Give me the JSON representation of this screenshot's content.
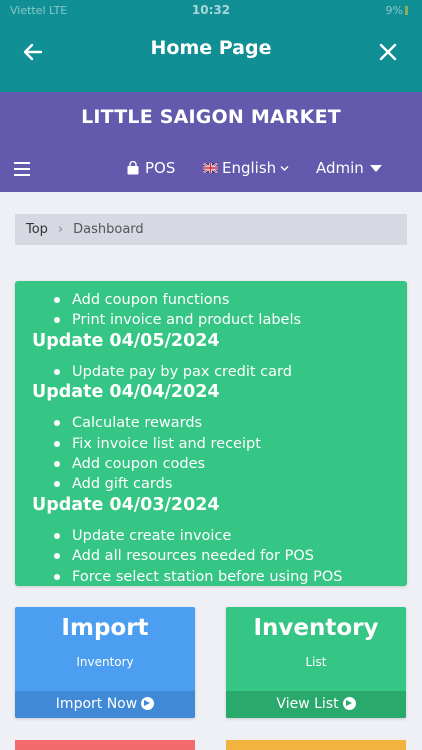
{
  "status_bar": {
    "carrier": "Viettel  LTE",
    "time": "10:32",
    "battery": "9%"
  },
  "header": {
    "title": "Home Page"
  },
  "nav": {
    "store_name": "LITTLE SAIGON MARKET",
    "pos_label": "POS",
    "language_label": "English",
    "admin_label": "Admin"
  },
  "breadcrumb": {
    "root": "Top",
    "current": "Dashboard"
  },
  "updates": {
    "top_items": [
      "Add coupon functions",
      "Print invoice and product labels"
    ],
    "sections": [
      {
        "title": "Update 04/05/2024",
        "items": [
          "Update pay by pax credit card"
        ]
      },
      {
        "title": "Update 04/04/2024",
        "items": [
          "Calculate rewards",
          "Fix invoice list and receipt",
          "Add coupon codes",
          "Add gift cards"
        ]
      },
      {
        "title": "Update 04/03/2024",
        "items": [
          "Update create invoice",
          "Add all resources needed for POS",
          "Force select station before using POS"
        ]
      }
    ]
  },
  "cards": {
    "import": {
      "title": "Import",
      "subtitle": "Inventory",
      "action": "Import Now"
    },
    "inventory": {
      "title": "Inventory",
      "subtitle": "List",
      "action": "View List"
    }
  },
  "colors": {
    "header": "#108f95",
    "nav": "#6359ad",
    "updates": "#35c584",
    "import_card": "#4c9ef0",
    "inventory_card": "#35c584"
  }
}
